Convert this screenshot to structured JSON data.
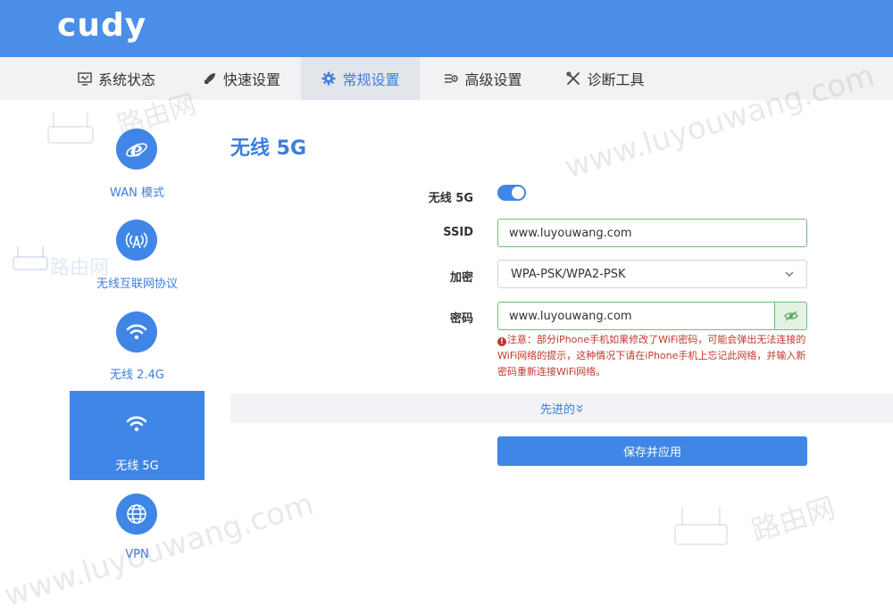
{
  "brand": {
    "logo": "cudy"
  },
  "nav": {
    "items": [
      {
        "label": "系统状态",
        "icon": "monitor-icon"
      },
      {
        "label": "快速设置",
        "icon": "rocket-icon"
      },
      {
        "label": "常规设置",
        "icon": "gear-icon",
        "active": true
      },
      {
        "label": "高级设置",
        "icon": "sliders-icon"
      },
      {
        "label": "诊断工具",
        "icon": "tools-icon"
      }
    ]
  },
  "sidebar": {
    "items": [
      {
        "label": "WAN 模式",
        "icon": "ie-icon"
      },
      {
        "label": "无线互联网协议",
        "icon": "antenna-icon"
      },
      {
        "label": "无线 2.4G",
        "icon": "wifi-icon"
      },
      {
        "label": "无线 5G",
        "icon": "wifi-icon",
        "active": true
      },
      {
        "label": "VPN",
        "icon": "globe-icon"
      }
    ]
  },
  "page": {
    "title": "无线 5G"
  },
  "form": {
    "wireless_label": "无线 5G",
    "wireless_enabled": true,
    "ssid_label": "SSID",
    "ssid_value": "www.luyouwang.com",
    "encryption_label": "加密",
    "encryption_value": "WPA-PSK/WPA2-PSK",
    "password_label": "密码",
    "password_value": "www.luyouwang.com",
    "warning_icon": "!",
    "warning": "注意：部分iPhone手机如果修改了WiFi密码，可能会弹出无法连接的WiFi网络的提示，这种情况下请在iPhone手机上忘记此网络，并输入新密码重新连接WiFi网络。"
  },
  "advanced": {
    "label": "先进的"
  },
  "actions": {
    "save_label": "保存并应用"
  },
  "watermark": {
    "text": "www.luyouwang.com",
    "logo_text": "路由网"
  },
  "colors": {
    "primary": "#4a8ee8",
    "accent": "#3f86e6",
    "warning": "#c0392b",
    "success_border": "#6fbf73"
  }
}
